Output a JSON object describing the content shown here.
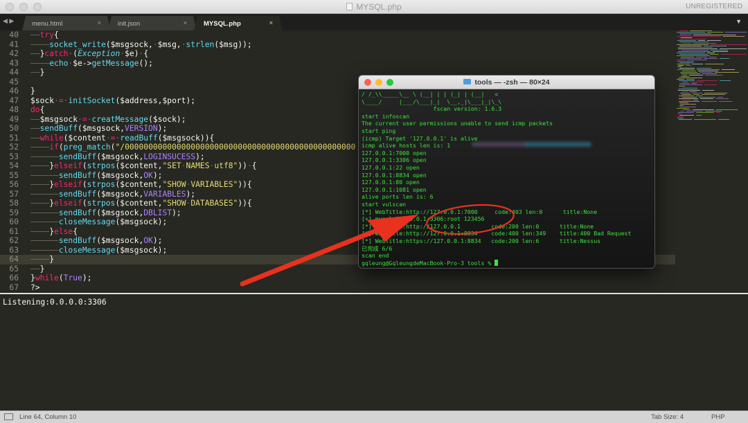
{
  "window": {
    "title": "MYSQL.php",
    "registration": "UNREGISTERED"
  },
  "tabs": [
    {
      "label": "menu.html",
      "close": "×"
    },
    {
      "label": "init.json",
      "close": "×"
    },
    {
      "label": "MYSQL.php",
      "close": "×"
    }
  ],
  "tabbar": {
    "nav_arrows": "◀ ▶",
    "dropdown": "▼"
  },
  "editor": {
    "current_line": 64,
    "lines": [
      {
        "n": "40",
        "html": "<span class=\"w\">——</span><span class=\"k\">try</span>{"
      },
      {
        "n": "41",
        "html": "<span class=\"w\">————</span><span class=\"f\">socket_write</span>($msgsock,<span class=\"w\">·</span>$msg,<span class=\"w\">·</span><span class=\"f\">strlen</span>($msg));"
      },
      {
        "n": "42",
        "html": "<span class=\"w\">——</span>}<span class=\"k\">catch</span><span class=\"w\">·</span>(<span class=\"i\">Exception</span><span class=\"w\">·</span>$e)<span class=\"w\">·</span>{"
      },
      {
        "n": "43",
        "html": "<span class=\"w\">————</span><span class=\"f\">echo</span><span class=\"w\">·</span>$e-><span class=\"f\">getMessage</span>();"
      },
      {
        "n": "44",
        "html": "<span class=\"w\">——</span>}"
      },
      {
        "n": "45",
        "html": ""
      },
      {
        "n": "46",
        "html": "}"
      },
      {
        "n": "47",
        "html": "$sock<span class=\"w\">·</span><span class=\"k\">=</span><span class=\"w\">·</span><span class=\"f\">initSocket</span>($address,$port);"
      },
      {
        "n": "48",
        "html": "<span class=\"k\">do</span>{"
      },
      {
        "n": "49",
        "html": "<span class=\"w\">——</span>$msgsock<span class=\"w\">·</span><span class=\"k\">=</span><span class=\"w\">·</span><span class=\"f\">creatMessage</span>($sock);"
      },
      {
        "n": "50",
        "html": "<span class=\"w\">——</span><span class=\"f\">sendBuff</span>($msgsock,<span class=\"c\">VERSION</span>);"
      },
      {
        "n": "51",
        "html": "<span class=\"w\">——</span><span class=\"k\">while</span>($content<span class=\"w\">·</span><span class=\"k\">=</span><span class=\"w\">·</span><span class=\"f\">readBuff</span>($msgsock)){"
      },
      {
        "n": "52",
        "html": "<span class=\"w\">————</span><span class=\"k\">if</span>(<span class=\"f\">preg_match</span>(<span class=\"s\">\"/0000000000000000000000000000000000000000000000000</span>"
      },
      {
        "n": "53",
        "html": "<span class=\"w\">——————</span><span class=\"f\">sendBuff</span>($msgsock,<span class=\"c\">LOGINSUCESS</span>);"
      },
      {
        "n": "54",
        "html": "<span class=\"w\">————</span>}<span class=\"k\">elseif</span>(<span class=\"f\">strpos</span>($content,<span class=\"s\">\"SET<span class=\"w\">·</span>NAMES<span class=\"w\">·</span>utf8\"</span>))<span class=\"w\">·</span>{"
      },
      {
        "n": "55",
        "html": "<span class=\"w\">——————</span><span class=\"f\">sendBuff</span>($msgsock,<span class=\"c\">OK</span>);"
      },
      {
        "n": "56",
        "html": "<span class=\"w\">————</span>}<span class=\"k\">elseif</span>(<span class=\"f\">strpos</span>($content,<span class=\"s\">\"SHOW<span class=\"w\">·</span>VARIABLES\"</span>)){"
      },
      {
        "n": "57",
        "html": "<span class=\"w\">——————</span><span class=\"f\">sendBuff</span>($msgsock,<span class=\"c\">VARIABLES</span>);"
      },
      {
        "n": "58",
        "html": "<span class=\"w\">————</span>}<span class=\"k\">elseif</span>(<span class=\"f\">strpos</span>($content,<span class=\"s\">\"SHOW<span class=\"w\">·</span>DATABASES\"</span>)){"
      },
      {
        "n": "59",
        "html": "<span class=\"w\">——————</span><span class=\"f\">sendBuff</span>($msgsock,<span class=\"c\">DBLIST</span>);"
      },
      {
        "n": "60",
        "html": "<span class=\"w\">——————</span><span class=\"f\">closeMessage</span>($msgsock);"
      },
      {
        "n": "61",
        "html": "<span class=\"w\">————</span>}<span class=\"k\">else</span>{"
      },
      {
        "n": "62",
        "html": "<span class=\"w\">——————</span><span class=\"f\">sendBuff</span>($msgsock,<span class=\"c\">OK</span>);"
      },
      {
        "n": "63",
        "html": "<span class=\"w\">——————</span><span class=\"f\">closeMessage</span>($msgsock);"
      },
      {
        "n": "64",
        "html": "<span class=\"w\">————</span>}"
      },
      {
        "n": "65",
        "html": "<span class=\"w\">——</span>}"
      },
      {
        "n": "66",
        "html": "}<span class=\"k\">while</span>(<span class=\"c\">True</span>);"
      },
      {
        "n": "67",
        "html": "?>"
      }
    ]
  },
  "console": {
    "output": "Listening:0.0.0.0:3306"
  },
  "statusbar": {
    "position": "Line 64, Column 10",
    "tab_size": "Tab Size: 4",
    "syntax": "PHP"
  },
  "terminal": {
    "title": "tools — -zsh — 80×24",
    "lines": [
      "/ /_\\\\_____\\__ \\ (__| | | (_| | (__|   <",
      "\\____/     |___/\\___|_|  \\__,_|\\___|_|\\_\\",
      "                     fscan version: 1.6.3",
      "start infoscan",
      "The current user permissions unable to send icmp packets",
      "start ping",
      "(icmp) Target '127.0.0.1' is alive",
      "icmp alive hosts len is: 1",
      "127.0.0.1:7000 open",
      "127.0.0.1:3306 open",
      "127.0.0.1:22 open",
      "127.0.0.1:8834 open",
      "127.0.0.1:80 open",
      "127.0.0.1:1081 open",
      "alive ports len is: 6",
      "start vulscan",
      "[*] WebTitle:http://127.0.0.1:7000     code:403 len:0      title:None",
      "[+] mysql:127.0.0.1:3306:root 123456",
      "[*] WebTitle:http://127.0.0.1         code:200 len:0      title:None",
      "[*] WebTitle:http://127.0.0.1:8834    code:400 len:349    title:400 Bad Request",
      "[*] WebTitle:https://127.0.0.1:8834   code:200 len:6      title:Nessus",
      "已完成 6/6",
      "scan end",
      "gqleung@GqleungdeMacBook-Pro-3 tools % "
    ]
  },
  "colors": {
    "editor_bg": "#272822",
    "keyword": "#f92672",
    "function": "#66d9ef",
    "string": "#e6db74",
    "constant": "#ae81ff",
    "terminal_text": "#3ee23e",
    "annotation": "#e8311f"
  }
}
